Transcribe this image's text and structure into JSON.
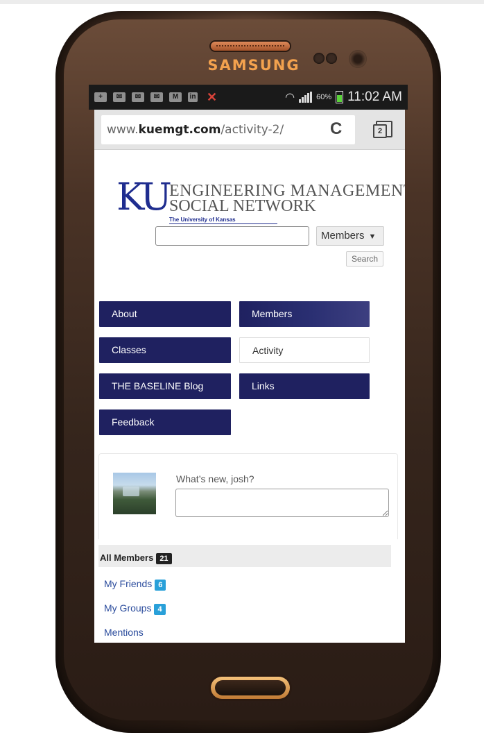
{
  "device": {
    "brand": "SAMSUNG"
  },
  "status_bar": {
    "battery_percent": "60%",
    "time": "11:02 AM",
    "notification_icons": [
      "add-icon",
      "mail-icon",
      "missed-message-icon",
      "missed-message-icon",
      "gmail-icon",
      "linkedin-icon",
      "missed-call-icon"
    ],
    "accent_battery": "#5ad23a"
  },
  "browser": {
    "url_domain_prefix": "www.",
    "url_domain": "kuemgt.com",
    "url_path": "/activity-2/",
    "tab_count": "2"
  },
  "site": {
    "logo_mark": "KU",
    "logo_line1": "ENGINEERING MANAGEMENT",
    "logo_line2": "SOCIAL NETWORK",
    "logo_sub": "The University of Kansas",
    "brand_color": "#1f2160"
  },
  "search": {
    "placeholder": "",
    "scope_selected": "Members",
    "button_label": "Search"
  },
  "nav": [
    {
      "label": "About"
    },
    {
      "label": "Members"
    },
    {
      "label": "Classes"
    },
    {
      "label": "Activity"
    },
    {
      "label": "THE BASELINE Blog"
    },
    {
      "label": "Links"
    },
    {
      "label": "Feedback"
    }
  ],
  "post": {
    "prompt": "What’s new, josh?",
    "value": ""
  },
  "filters": {
    "all_members_label": "All Members",
    "all_members_count": "21",
    "my_friends_label": "My Friends",
    "my_friends_count": "6",
    "my_groups_label": "My Groups",
    "my_groups_count": "4",
    "mentions_label": "Mentions"
  }
}
